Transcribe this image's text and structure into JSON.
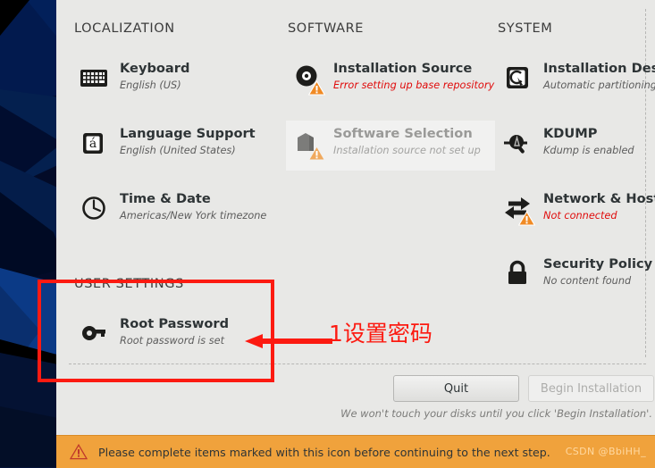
{
  "window": {
    "app": "anaconda-installation-summary"
  },
  "columns": [
    {
      "title": "LOCALIZATION",
      "items": [
        {
          "icon": "keyboard-icon",
          "title": "Keyboard",
          "status": "English (US)",
          "state": "normal",
          "warning": false
        },
        {
          "icon": "language-support-icon",
          "title": "Language Support",
          "status": "English (United States)",
          "state": "normal",
          "warning": false
        },
        {
          "icon": "time-and-date-clock-icon",
          "title": "Time & Date",
          "status": "Americas/New York timezone",
          "state": "normal",
          "warning": false
        }
      ]
    },
    {
      "title": "SOFTWARE",
      "items": [
        {
          "icon": "installation-source-disc-icon",
          "title": "Installation Source",
          "status": "Error setting up base repository",
          "state": "error",
          "warning": true
        },
        {
          "icon": "software-selection-package-icon",
          "title": "Software Selection",
          "status": "Installation source not set up",
          "state": "disabled",
          "warning": true
        }
      ]
    },
    {
      "title": "SYSTEM",
      "items": [
        {
          "icon": "installation-destination-disk-icon",
          "title": "Installation Destination",
          "status": "Automatic partitioning selected",
          "state": "normal",
          "warning": false
        },
        {
          "icon": "kdump-magnifier-icon",
          "title": "KDUMP",
          "status": "Kdump is enabled",
          "state": "normal",
          "warning": false
        },
        {
          "icon": "network-host-name-icon",
          "title": "Network & Host Name",
          "status": "Not connected",
          "state": "error",
          "warning": true
        },
        {
          "icon": "security-policy-lock-icon",
          "title": "Security Policy",
          "status": "No content found",
          "state": "normal",
          "warning": false
        }
      ]
    }
  ],
  "user_settings": {
    "title": "USER SETTINGS",
    "items": [
      {
        "icon": "root-password-key-icon",
        "title": "Root Password",
        "status": "Root password is set",
        "state": "normal",
        "warning": false
      }
    ]
  },
  "actions": {
    "quit_label": "Quit",
    "begin_label": "Begin Installation",
    "disclaimer": "We won't touch your disks until you click 'Begin Installation'."
  },
  "warning_bar": {
    "icon": "warning-triangle-icon",
    "message": "Please complete items marked with this icon before continuing to the next step."
  },
  "watermark": {
    "text": "CSDN @BbiHH_"
  },
  "annotation": {
    "text": "1设置密码",
    "color": "#fc1a11"
  },
  "colors": {
    "panel_bg": "#e8e8e6",
    "error_text": "#e00b0b",
    "warn_bar": "#f0a23c",
    "annotation": "#fc1a11",
    "wallpaper": "#030b28"
  }
}
